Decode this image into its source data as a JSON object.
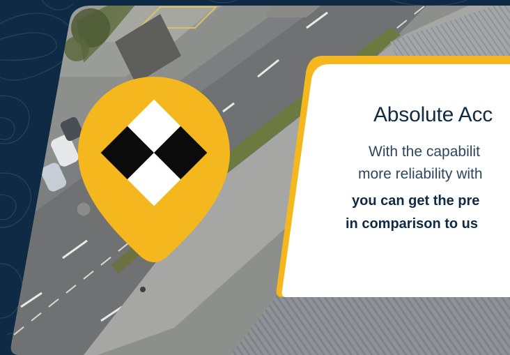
{
  "card": {
    "title": "Absolute Acc",
    "line1": "With the capabilit",
    "line2": "more reliability with",
    "line3": "you can get the pre",
    "line4": "in comparison to us"
  },
  "pin": {
    "icon": "checkered-marker-icon"
  },
  "colors": {
    "background": "#0f2a44",
    "accent": "#f4b81e",
    "card": "#ffffff",
    "title": "#0f2a44"
  }
}
